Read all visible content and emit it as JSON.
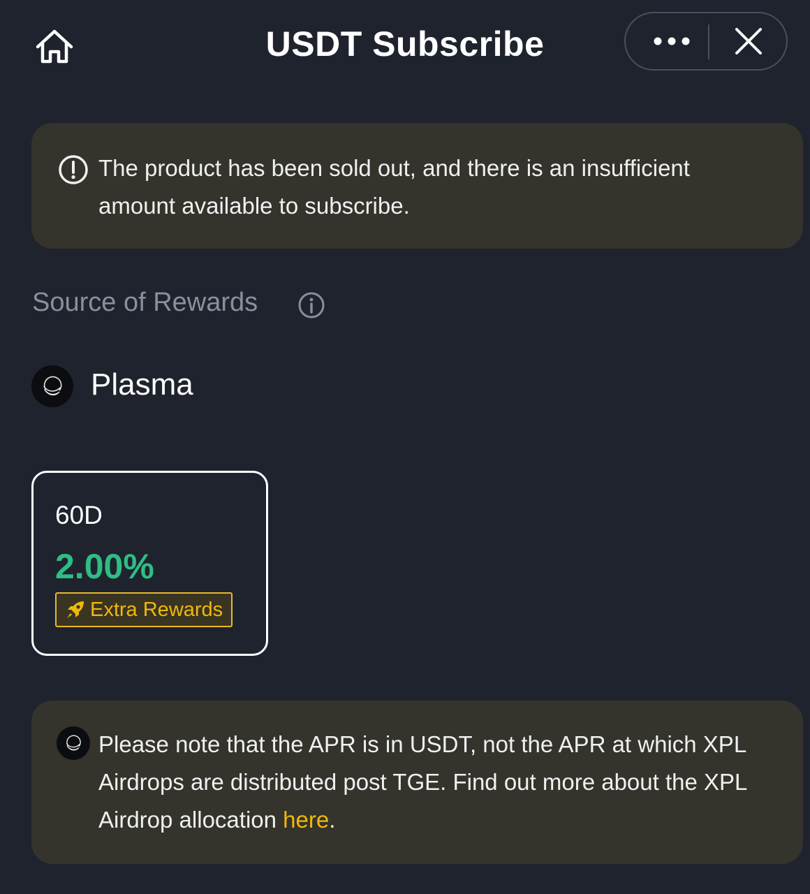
{
  "header": {
    "title": "USDT Subscribe",
    "home_icon": "home-icon",
    "more_icon": "more-horizontal-icon",
    "close_icon": "close-icon"
  },
  "banner": {
    "icon": "alert-circle-icon",
    "text": "The product has been sold out, and there is an insufficient amount available to subscribe."
  },
  "source": {
    "section_label": "Source of Rewards",
    "info_icon": "info-icon",
    "name": "Plasma",
    "logo_icon": "plasma-logo-icon"
  },
  "terms": [
    {
      "duration": "60D",
      "apr": "2.00%",
      "badge_label": "Extra Rewards",
      "badge_icon": "rocket-icon",
      "selected": true
    }
  ],
  "note": {
    "logo_icon": "plasma-logo-icon",
    "text_before": "Please note that the APR is in USDT, not the APR at which XPL Airdrops are distributed post TGE. Find out more about the XPL Airdrop allocation ",
    "link_label": "here",
    "text_after": "."
  },
  "colors": {
    "background": "#1f232e",
    "panel": "#34332c",
    "apr_green": "#2ebd85",
    "accent_yellow": "#f0b90b",
    "muted_text": "#8a8f9b"
  }
}
